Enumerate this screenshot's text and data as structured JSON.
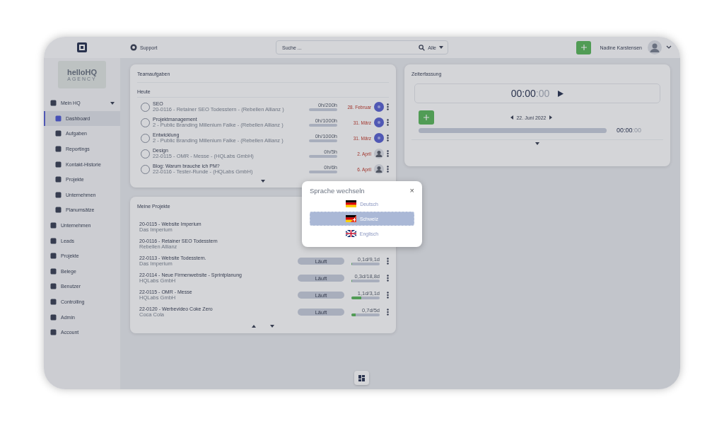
{
  "topbar": {
    "support": "Support",
    "search": {
      "placeholder": "Suche ...",
      "scope": "Alle"
    },
    "user": "Nadine Karstensen"
  },
  "brand": {
    "name": "helloHQ",
    "tagline": "AGENCY"
  },
  "sidebar": {
    "items": [
      {
        "label": "Mein HQ",
        "selected": false,
        "expanded": true,
        "children": [
          {
            "label": "Dashboard",
            "selected": true
          },
          {
            "label": "Aufgaben",
            "selected": false
          },
          {
            "label": "Reportings",
            "selected": false
          },
          {
            "label": "Kontakt-Historie",
            "selected": false
          },
          {
            "label": "Projekte",
            "selected": false
          },
          {
            "label": "Unternehmen",
            "selected": false
          },
          {
            "label": "Planumsätze",
            "selected": false
          }
        ]
      },
      {
        "label": "Unternehmen",
        "selected": false
      },
      {
        "label": "Leads",
        "selected": false
      },
      {
        "label": "Projekte",
        "selected": false
      },
      {
        "label": "Belege",
        "selected": false
      },
      {
        "label": "Benutzer",
        "selected": false
      },
      {
        "label": "Controlling",
        "selected": false
      },
      {
        "label": "Admin",
        "selected": false
      },
      {
        "label": "Account",
        "selected": false
      }
    ]
  },
  "team_tasks": {
    "title": "Teamaufgaben",
    "section": "Heute",
    "rows": [
      {
        "name": "SEO",
        "project": "20-0116 - Retainer SEO Todesstern - (Rebellen Allianz )",
        "hours": "0h/200h",
        "level": 0,
        "date": "28. Februar",
        "avatar": {
          "kind": "initials"
        },
        "checked": false
      },
      {
        "name": "Projektmanagement",
        "project": "2 - Public Branding Millenium Falke - (Rebellen Allianz )",
        "hours": "0h/1000h",
        "level": 0,
        "date": "31. März",
        "avatar": {
          "kind": "initials"
        },
        "checked": false
      },
      {
        "name": "Entwicklung",
        "project": "2 - Public Branding Millenium Falke - (Rebellen Allianz )",
        "hours": "0h/1000h",
        "level": 0,
        "date": "31. März",
        "avatar": {
          "kind": "initials"
        },
        "checked": false
      },
      {
        "name": "Design",
        "project": "22-0115 - OMR - Messe - (HQLabs GmbH)",
        "hours": "0h/5h",
        "level": 0,
        "date": "2. April",
        "avatar": {
          "kind": "photo"
        },
        "checked": false
      },
      {
        "name": "Blog: Warum brauche ich PM?",
        "project": "22-0116 - Tester-Runde - (HQLabs GmbH)",
        "hours": "0h/6h",
        "level": 0,
        "date": "6. April",
        "avatar": {
          "kind": "photo"
        },
        "checked": false
      }
    ]
  },
  "projects": {
    "title": "Meine Projekte",
    "rows": [
      {
        "name": "20-0115 - Website Imperium",
        "client": "Das Imperium"
      },
      {
        "name": "20-0116 - Retainer SEO Todesstern",
        "client": "Rebellen Allianz"
      },
      {
        "name": "22-0113 - Website Todesstern.",
        "client": "Das Imperium",
        "status": "Läuft",
        "hours": "0,1d/9,1d",
        "level": 0.01
      },
      {
        "name": "22-0114 - Neue Firmenwebsite - Sprintplanung",
        "client": "HQLabs GmbH",
        "status": "Läuft",
        "hours": "0,3d/18,8d",
        "level": 0.02
      },
      {
        "name": "22-0115 - OMR - Messe",
        "client": "HQLabs GmbH",
        "status": "Läuft",
        "hours": "1,1d/3,1d",
        "level": 0.35
      },
      {
        "name": "22-0120 - Werbevideo Coke Zero",
        "client": "Coca Cola",
        "status": "Läuft",
        "hours": "0,7d/5d",
        "level": 0.14
      }
    ]
  },
  "time_tracking": {
    "title": "Zeiterfassung",
    "timer": "00:00",
    "timer_seconds": ":00",
    "date": "22. Juni 2022",
    "total": "00:00",
    "total_seconds": ":00",
    "level": 0
  },
  "language_dialog": {
    "title": "Sprache wechseln",
    "close": "×",
    "options": [
      {
        "label": "Deutsch",
        "flag": {
          "kind": "de"
        },
        "selected": false
      },
      {
        "label": "Schweiz",
        "flag": {
          "kind": "ch"
        },
        "selected": true
      },
      {
        "label": "Englisch",
        "flag": {
          "kind": "gb"
        },
        "selected": false
      }
    ]
  }
}
